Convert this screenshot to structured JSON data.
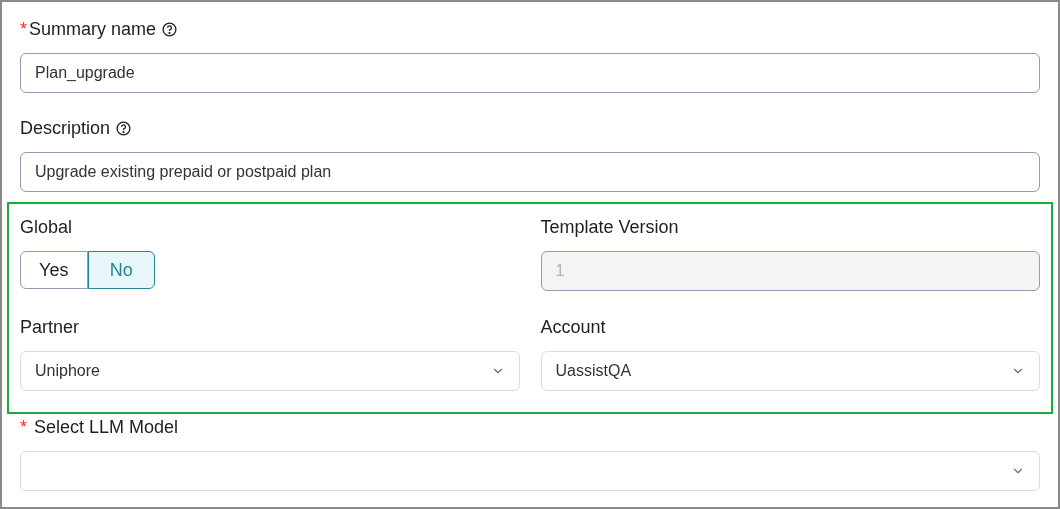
{
  "fields": [
    {
      "label": "Summary name",
      "required_mark": "*",
      "help": true,
      "value": "Plan_upgrade"
    },
    {
      "label": "Description",
      "help": true,
      "value": "Upgrade existing prepaid or postpaid plan"
    }
  ],
  "highlighted_group": {
    "global": {
      "label": "Global",
      "options": [
        {
          "label": "Yes",
          "selected": false
        },
        {
          "label": "No",
          "selected": true
        }
      ]
    },
    "template_version": {
      "label": "Template Version",
      "value": "1",
      "disabled": true
    },
    "partner": {
      "label": "Partner",
      "value": "Uniphore"
    },
    "account": {
      "label": "Account",
      "value": "UassistQA"
    }
  },
  "llm_model": {
    "label": "Select LLM Model",
    "required_mark": "*"
  }
}
